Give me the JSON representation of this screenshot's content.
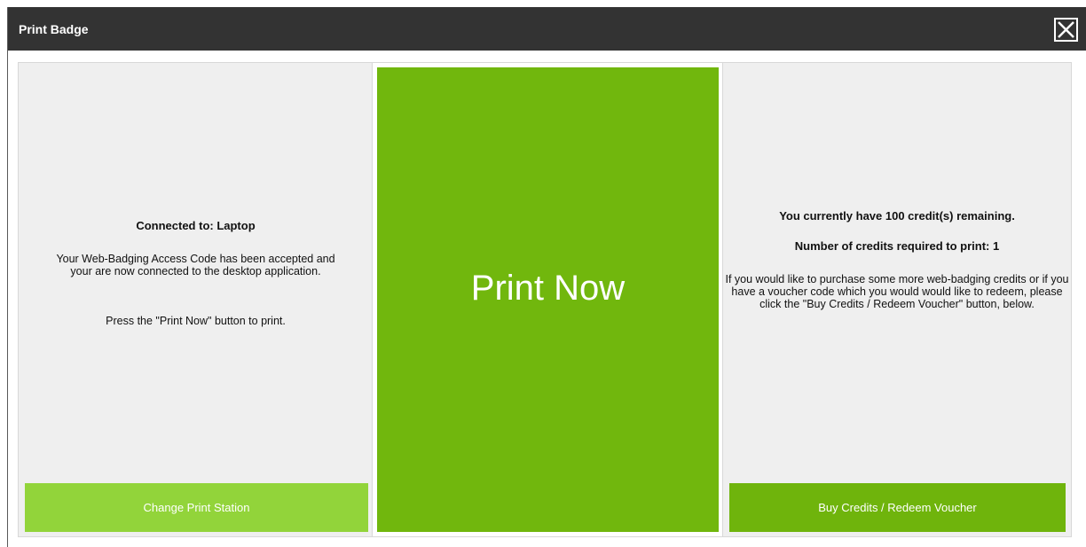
{
  "dialog": {
    "title": "Print Badge",
    "close_icon": "close-icon"
  },
  "left_panel": {
    "heading": "Connected to: Laptop",
    "body": "Your Web-Badging Access Code has been accepted and your are now connected to the desktop application.",
    "instruction": "Press the \"Print Now\" button to print.",
    "button_label": "Change Print Station"
  },
  "center": {
    "print_label": "Print Now"
  },
  "right_panel": {
    "credits_remaining": "You currently have 100 credit(s) remaining.",
    "credits_required": "Number of credits required to print: 1",
    "body": "If you would like to purchase some more web-badging credits or if you have a voucher code which you would would like to redeem, please click the \"Buy Credits / Redeem Voucher\" button, below.",
    "button_label": "Buy Credits / Redeem Voucher"
  },
  "colors": {
    "titlebar": "#333333",
    "print_green": "#71b70d",
    "light_green": "#92d43a",
    "dark_green": "#6fb40c",
    "panel_bg": "#efefef"
  }
}
